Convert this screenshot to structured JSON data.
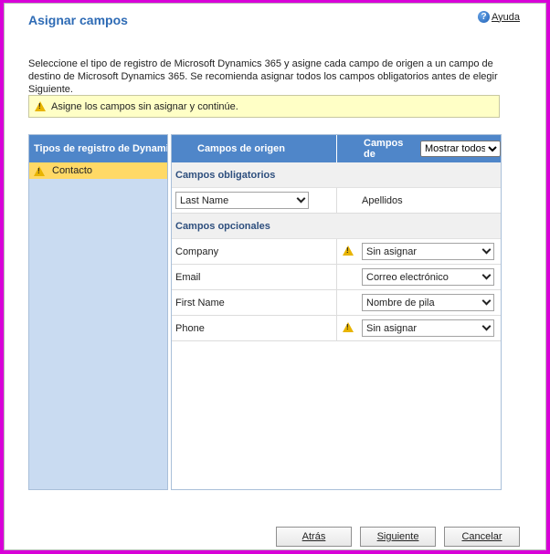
{
  "dialog": {
    "title": "Asignar campos",
    "help_label": "Ayuda",
    "description": "Seleccione el tipo de registro de Microsoft Dynamics 365 y asigne cada campo de origen a un campo de destino de Microsoft Dynamics 365. Se recomienda asignar todos los campos obligatorios antes de elegir Siguiente.",
    "warning": "Asigne los campos sin asignar y continúe."
  },
  "left_panel": {
    "header": "Tipos de registro de Dynamics",
    "items": [
      {
        "label": "Contacto",
        "warning": true
      }
    ]
  },
  "grid": {
    "header_source": "Campos de origen",
    "header_target": "Campos de",
    "filter_selected": "Mostrar todos",
    "required_section": "Campos obligatorios",
    "required_rows": [
      {
        "source": "Last Name",
        "target": "Apellidos"
      }
    ],
    "optional_section": "Campos opcionales",
    "optional_rows": [
      {
        "source": "Company",
        "target": "Sin asignar",
        "warning": true
      },
      {
        "source": "Email",
        "target": "Correo electrónico",
        "warning": false
      },
      {
        "source": "First Name",
        "target": "Nombre de pila",
        "warning": false
      },
      {
        "source": "Phone",
        "target": "Sin asignar",
        "warning": true
      }
    ]
  },
  "buttons": {
    "back": "Atrás",
    "next": "Siguiente",
    "cancel": "Cancelar"
  },
  "colors": {
    "title": "#2e6bb5",
    "header_blue": "#4f86c9",
    "left_panel": "#c9dbf1",
    "selected_item": "#ffd966",
    "warning_bar": "#ffffc6",
    "warning_icon": "#e8b400",
    "frame_border": "#d800d8"
  }
}
